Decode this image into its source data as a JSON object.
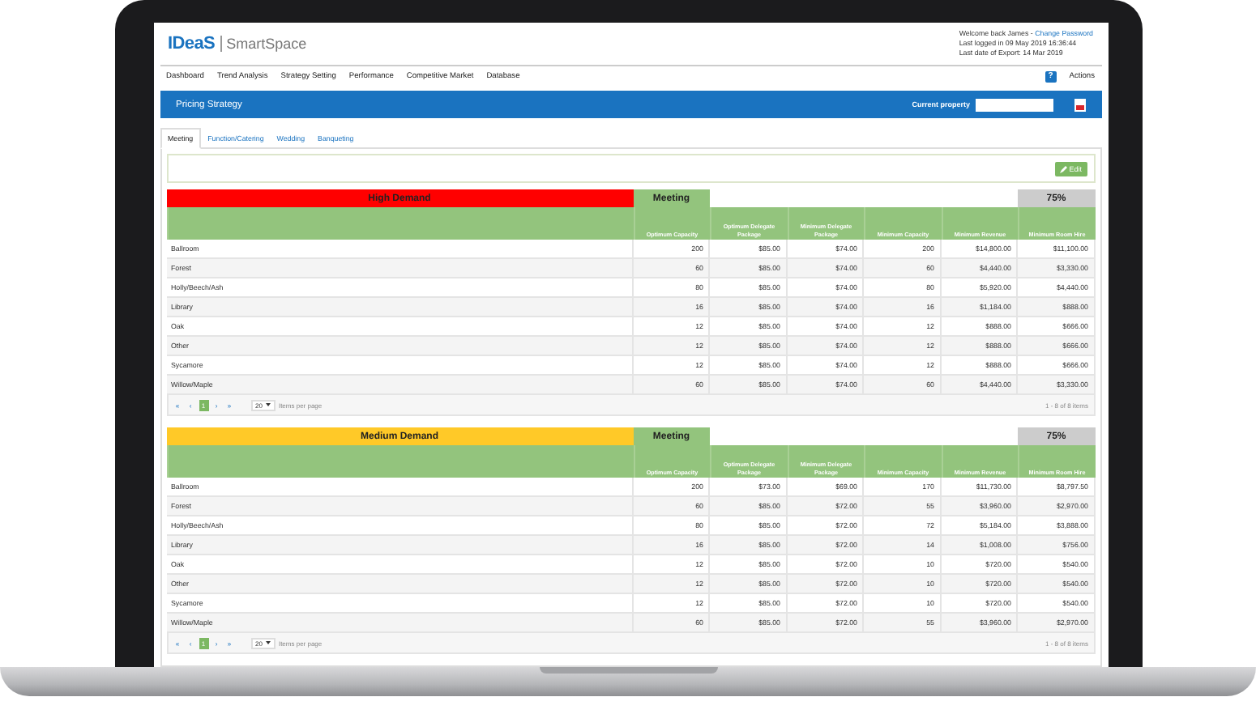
{
  "header": {
    "logo": "IDeaS",
    "product": "SmartSpace",
    "welcome": "Welcome back James -",
    "account_link": "Change Password",
    "last_logged": "Last logged in 09 May 2019 16:36:44",
    "last_export": "Last date of Export: 14 Mar 2019"
  },
  "nav": {
    "items": [
      "Dashboard",
      "Trend Analysis",
      "Strategy Setting",
      "Performance",
      "Competitive Market",
      "Database"
    ],
    "help": "?",
    "actions": "Actions"
  },
  "title_bar": {
    "title": "Pricing Strategy",
    "property_label": "Current property"
  },
  "tabs": [
    {
      "label": "Meeting",
      "selected": true
    },
    {
      "label": "Function/Catering",
      "selected": false
    },
    {
      "label": "Wedding",
      "selected": false
    },
    {
      "label": "Banqueting",
      "selected": false
    }
  ],
  "edit_button": "Edit",
  "tables": [
    {
      "demand": "High Demand",
      "color": "#ff0000",
      "segment": "Meeting",
      "percent": "75%",
      "columns": [
        "",
        "Optimum Capacity",
        "Optimum Delegate Package",
        "Minimum Delegate Package",
        "Minimum Capacity",
        "Minimum Revenue",
        "Minimum Room Hire"
      ],
      "rows": [
        [
          "Ballroom",
          "200",
          "$85.00",
          "$74.00",
          "200",
          "$14,800.00",
          "$11,100.00"
        ],
        [
          "Forest",
          "60",
          "$85.00",
          "$74.00",
          "60",
          "$4,440.00",
          "$3,330.00"
        ],
        [
          "Holly/Beech/Ash",
          "80",
          "$85.00",
          "$74.00",
          "80",
          "$5,920.00",
          "$4,440.00"
        ],
        [
          "Library",
          "16",
          "$85.00",
          "$74.00",
          "16",
          "$1,184.00",
          "$888.00"
        ],
        [
          "Oak",
          "12",
          "$85.00",
          "$74.00",
          "12",
          "$888.00",
          "$666.00"
        ],
        [
          "Other",
          "12",
          "$85.00",
          "$74.00",
          "12",
          "$888.00",
          "$666.00"
        ],
        [
          "Sycamore",
          "12",
          "$85.00",
          "$74.00",
          "12",
          "$888.00",
          "$666.00"
        ],
        [
          "Willow/Maple",
          "60",
          "$85.00",
          "$74.00",
          "60",
          "$4,440.00",
          "$3,330.00"
        ]
      ],
      "pager": {
        "first": "«",
        "prev": "‹",
        "pages": [
          {
            "label": "1",
            "selected": true
          }
        ],
        "next": "›",
        "last": "»",
        "per_page": "20",
        "per_page_label": "Items per page",
        "summary": "1 - 8 of 8 items"
      }
    },
    {
      "demand": "Medium Demand",
      "color": "#ffc928",
      "segment": "Meeting",
      "percent": "75%",
      "columns": [
        "",
        "Optimum Capacity",
        "Optimum Delegate Package",
        "Minimum Delegate Package",
        "Minimum Capacity",
        "Minimum Revenue",
        "Minimum Room Hire"
      ],
      "rows": [
        [
          "Ballroom",
          "200",
          "$73.00",
          "$69.00",
          "170",
          "$11,730.00",
          "$8,797.50"
        ],
        [
          "Forest",
          "60",
          "$85.00",
          "$72.00",
          "55",
          "$3,960.00",
          "$2,970.00"
        ],
        [
          "Holly/Beech/Ash",
          "80",
          "$85.00",
          "$72.00",
          "72",
          "$5,184.00",
          "$3,888.00"
        ],
        [
          "Library",
          "16",
          "$85.00",
          "$72.00",
          "14",
          "$1,008.00",
          "$756.00"
        ],
        [
          "Oak",
          "12",
          "$85.00",
          "$72.00",
          "10",
          "$720.00",
          "$540.00"
        ],
        [
          "Other",
          "12",
          "$85.00",
          "$72.00",
          "10",
          "$720.00",
          "$540.00"
        ],
        [
          "Sycamore",
          "12",
          "$85.00",
          "$72.00",
          "10",
          "$720.00",
          "$540.00"
        ],
        [
          "Willow/Maple",
          "60",
          "$85.00",
          "$72.00",
          "55",
          "$3,960.00",
          "$2,970.00"
        ]
      ],
      "pager": {
        "first": "«",
        "prev": "‹",
        "pages": [
          {
            "label": "1",
            "selected": true
          }
        ],
        "next": "›",
        "last": "»",
        "per_page": "20",
        "per_page_label": "Items per page",
        "summary": "1 - 8 of 8 items"
      }
    }
  ]
}
